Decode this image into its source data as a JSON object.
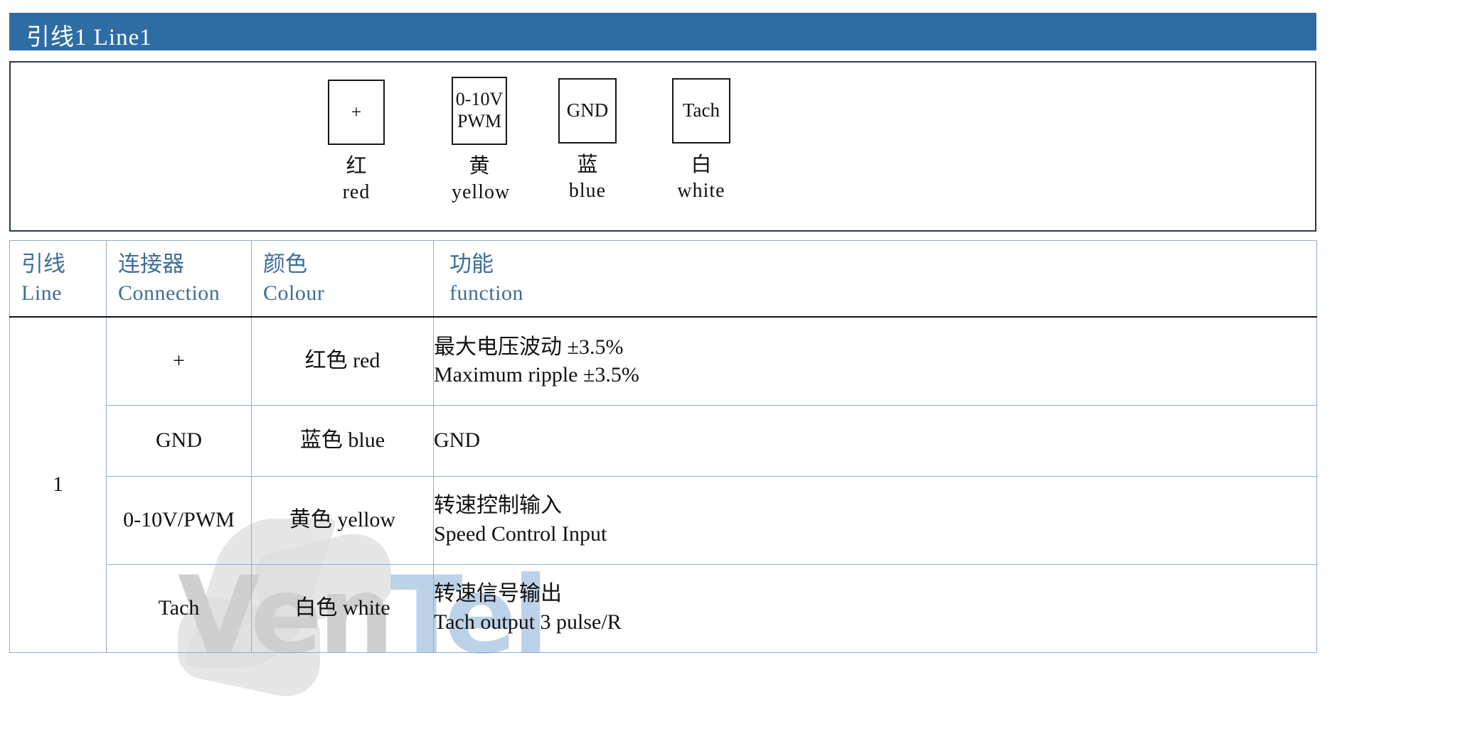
{
  "banner": {
    "title": "引线1 Line1"
  },
  "diagram": {
    "connectors": [
      {
        "box_line1": "+",
        "box_line2": "",
        "cn": "红",
        "en": "red"
      },
      {
        "box_line1": "0-10V",
        "box_line2": "PWM",
        "cn": "黄",
        "en": "yellow"
      },
      {
        "box_line1": "GND",
        "box_line2": "",
        "cn": "蓝",
        "en": "blue"
      },
      {
        "box_line1": "Tach",
        "box_line2": "",
        "cn": "白",
        "en": "white"
      }
    ]
  },
  "table": {
    "headers": [
      {
        "cn": "引线",
        "en": "Line"
      },
      {
        "cn": "连接器",
        "en": "Connection"
      },
      {
        "cn": "颜色",
        "en": "Colour"
      },
      {
        "cn": "功能",
        "en": "function"
      }
    ],
    "line_number": "1",
    "rows": [
      {
        "connection": "+",
        "colour": "红色 red",
        "function_cn": "最大电压波动 ±3.5%",
        "function_en": "Maximum ripple ±3.5%"
      },
      {
        "connection": "GND",
        "colour": "蓝色 blue",
        "function_cn": "GND",
        "function_en": ""
      },
      {
        "connection": "0-10V/PWM",
        "colour": "黄色 yellow",
        "function_cn": "转速控制输入",
        "function_en": "Speed Control Input"
      },
      {
        "connection": "Tach",
        "colour": "白色 white",
        "function_cn": "转速信号输出",
        "function_en": "Tach output 3 pulse/R"
      }
    ]
  },
  "watermark": {
    "text_a": "Ven",
    "text_b": "Tel"
  },
  "colors": {
    "banner_blue": "#2e6da4",
    "header_text_blue": "#3f6d97",
    "table_border": "#93aec3",
    "diagram_border": "#2b3a44"
  }
}
